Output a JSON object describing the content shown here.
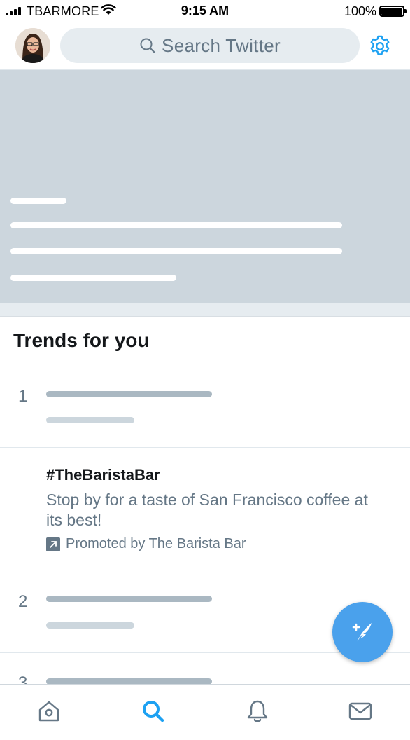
{
  "status_bar": {
    "carrier": "TBARMORE",
    "time": "9:15 AM",
    "battery": "100%",
    "battery_level": 1.0
  },
  "header": {
    "search_placeholder": "Search Twitter",
    "avatar": "user-avatar",
    "settings_icon": "gear-icon",
    "accent_color": "#1da1f2"
  },
  "trends": {
    "title": "Trends for you",
    "rows": [
      {
        "rank": "1"
      },
      {
        "promoted": true,
        "hashtag": "#TheBaristaBar",
        "description": "Stop by for a taste of San Francisco coffee at its best!",
        "promoted_by": "Promoted by The Barista Bar"
      },
      {
        "rank": "2"
      },
      {
        "rank": "3"
      }
    ]
  },
  "fab": {
    "icon": "compose-tweet-icon",
    "color": "#4aa1ec"
  },
  "tab_bar": {
    "items": [
      {
        "icon": "home-icon",
        "active": false
      },
      {
        "icon": "search-icon",
        "active": true
      },
      {
        "icon": "notifications-bell-icon",
        "active": false
      },
      {
        "icon": "messages-envelope-icon",
        "active": false
      }
    ]
  }
}
